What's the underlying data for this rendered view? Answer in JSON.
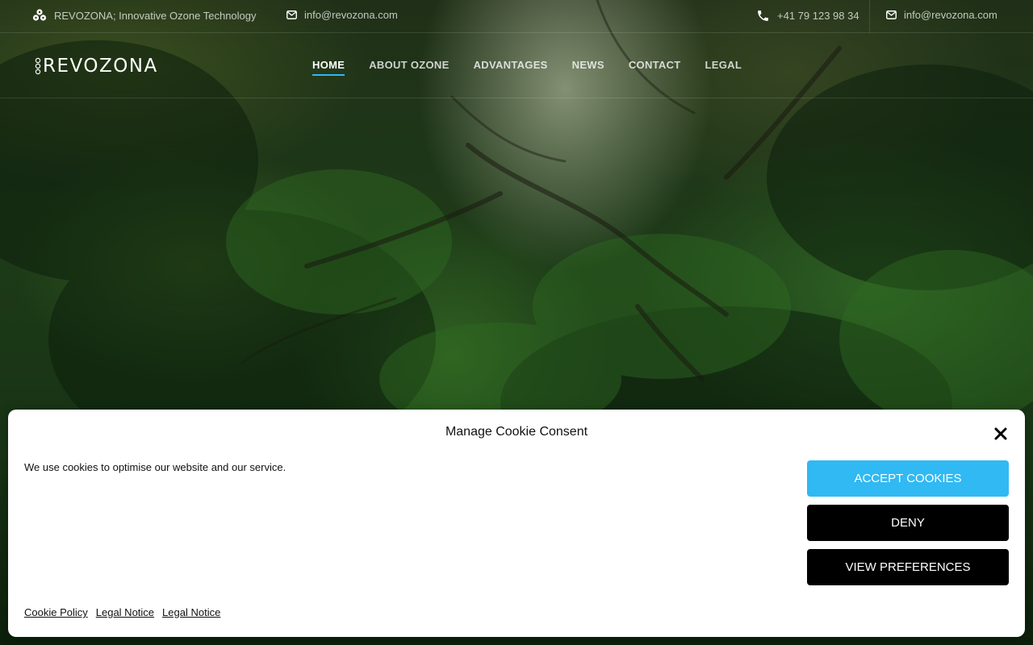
{
  "topbar": {
    "tagline": "REVOZONA; Innovative Ozone Technology",
    "email_left": "info@revozona.com",
    "phone": "+41 79 123 98 34",
    "email_right": "info@revozona.com"
  },
  "logo": {
    "text": "REVOZONA"
  },
  "nav": {
    "items": [
      {
        "label": "HOME",
        "active": true
      },
      {
        "label": "ABOUT OZONE"
      },
      {
        "label": "ADVANTAGES"
      },
      {
        "label": "NEWS"
      },
      {
        "label": "CONTACT"
      },
      {
        "label": "LEGAL"
      }
    ]
  },
  "cookie": {
    "title": "Manage Cookie Consent",
    "message": "We use cookies to optimise our website and our service.",
    "accept_label": "ACCEPT COOKIES",
    "deny_label": "DENY",
    "preferences_label": "VIEW PREFERENCES",
    "links": [
      "Cookie Policy",
      "Legal Notice",
      "Legal Notice"
    ]
  },
  "colors": {
    "accent": "#30b9f2",
    "button_dark": "#000000",
    "banner_bg": "#ffffff"
  },
  "icons": {
    "tagline": "molecule-icon",
    "email": "envelope-icon",
    "phone": "phone-icon",
    "close": "close-icon"
  }
}
